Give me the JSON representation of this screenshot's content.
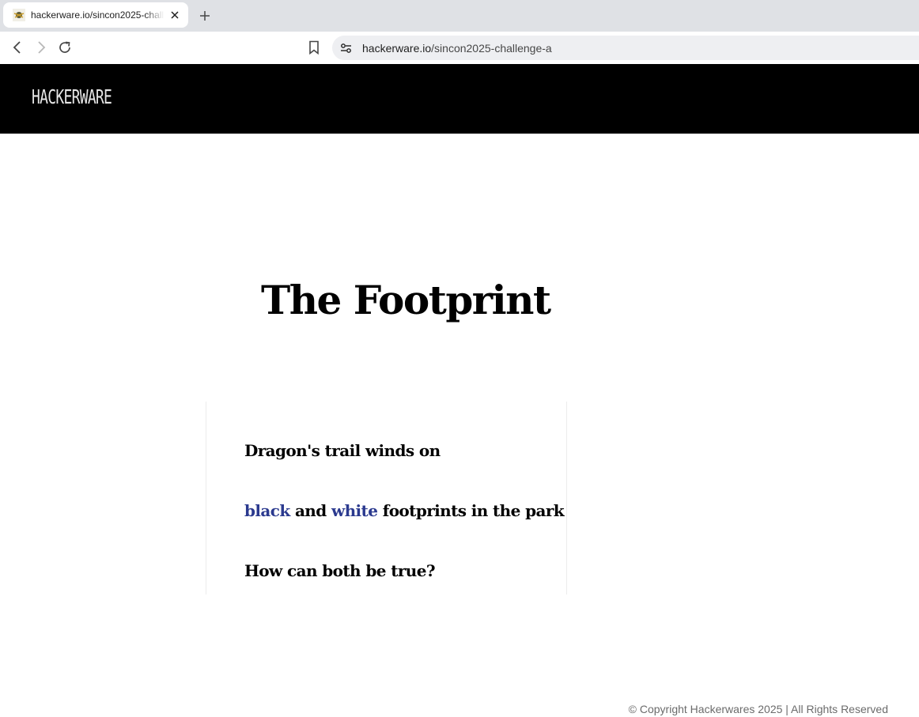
{
  "browser": {
    "tab_title": "hackerware.io/sincon2025-challenge-a",
    "url_host": "hackerware.io",
    "url_path": "/sincon2025-challenge-a"
  },
  "header": {
    "logo_text": "HACKERWARE"
  },
  "main": {
    "title": "The Footprint",
    "poem": {
      "line1": "Dragon's trail winds on",
      "line2_word1": "black",
      "line2_word2": " and ",
      "line2_word3": "white",
      "line2_rest": " footprints in the park",
      "line3": "How can both be true?"
    }
  },
  "footer": {
    "copyright": "© Copyright Hackerwares 2025 | All Rights Reserved"
  },
  "colors": {
    "header_bg": "#000000",
    "highlight": "#2b3a8f",
    "text": "#000000"
  }
}
